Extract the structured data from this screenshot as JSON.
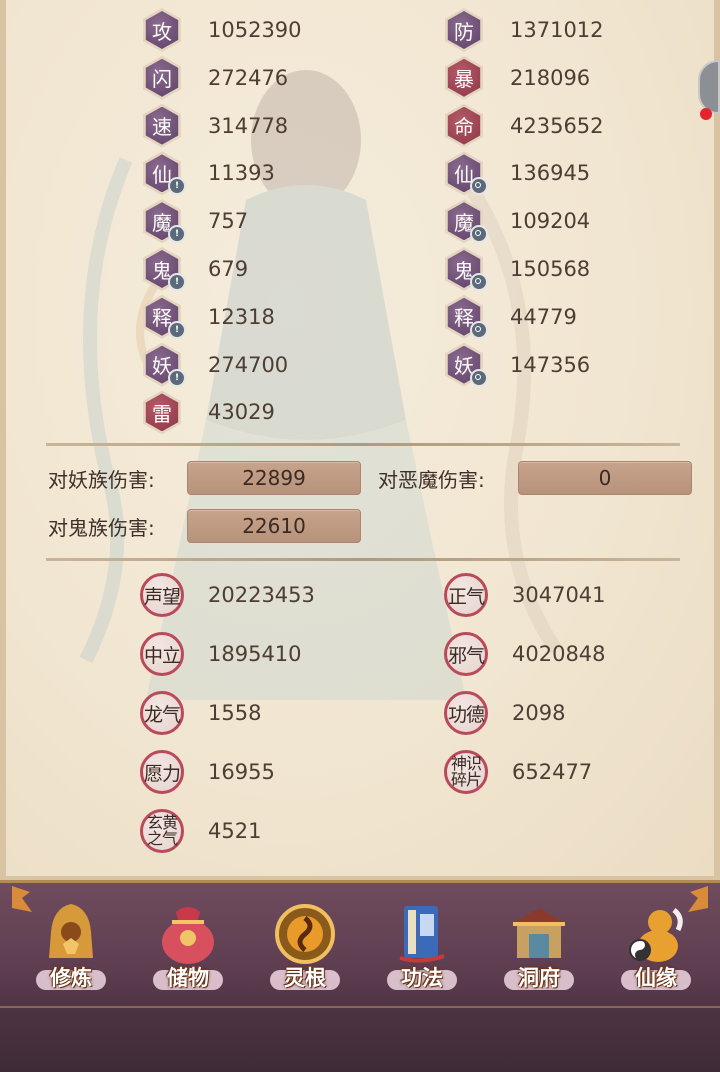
{
  "left_stats": [
    {
      "glyph": "攻",
      "value": "1052390",
      "color": "purple",
      "badge": ""
    },
    {
      "glyph": "闪",
      "value": "272476",
      "color": "purple",
      "badge": ""
    },
    {
      "glyph": "速",
      "value": "314778",
      "color": "purple",
      "badge": ""
    },
    {
      "glyph": "仙",
      "value": "11393",
      "color": "purple",
      "badge": "i"
    },
    {
      "glyph": "魔",
      "value": "757",
      "color": "purple",
      "badge": "i"
    },
    {
      "glyph": "鬼",
      "value": "679",
      "color": "purple",
      "badge": "i"
    },
    {
      "glyph": "释",
      "value": "12318",
      "color": "purple",
      "badge": "i"
    },
    {
      "glyph": "妖",
      "value": "274700",
      "color": "purple",
      "badge": "i"
    },
    {
      "glyph": "雷",
      "value": "43029",
      "color": "red",
      "badge": ""
    }
  ],
  "right_stats": [
    {
      "glyph": "防",
      "value": "1371012",
      "color": "purple",
      "badge": ""
    },
    {
      "glyph": "暴",
      "value": "218096",
      "color": "red",
      "badge": ""
    },
    {
      "glyph": "命",
      "value": "4235652",
      "color": "red",
      "badge": ""
    },
    {
      "glyph": "仙",
      "value": "136945",
      "color": "purple",
      "badge": "o"
    },
    {
      "glyph": "魔",
      "value": "109204",
      "color": "purple",
      "badge": "o"
    },
    {
      "glyph": "鬼",
      "value": "150568",
      "color": "purple",
      "badge": "o"
    },
    {
      "glyph": "释",
      "value": "44779",
      "color": "purple",
      "badge": "o"
    },
    {
      "glyph": "妖",
      "value": "147356",
      "color": "purple",
      "badge": "o"
    }
  ],
  "damage": {
    "demon_label": "对妖族伤害:",
    "demon_value": "22899",
    "evil_label": "对恶魔伤害:",
    "evil_value": "0",
    "ghost_label": "对鬼族伤害:",
    "ghost_value": "22610"
  },
  "reputation": [
    {
      "label": "声望",
      "value": "20223453"
    },
    {
      "label": "正气",
      "value": "3047041"
    },
    {
      "label": "中立",
      "value": "1895410"
    },
    {
      "label": "邪气",
      "value": "4020848"
    },
    {
      "label": "龙气",
      "value": "1558"
    },
    {
      "label": "功德",
      "value": "2098"
    },
    {
      "label": "愿力",
      "value": "16955"
    },
    {
      "label_line1": "神识",
      "label_line2": "碎片",
      "value": "652477"
    },
    {
      "label_line1": "玄黄",
      "label_line2": "之气",
      "value": "4521"
    }
  ],
  "nav": [
    {
      "label": "修炼",
      "icon": "cultivate-icon"
    },
    {
      "label": "储物",
      "icon": "storage-bag-icon"
    },
    {
      "label": "灵根",
      "icon": "spirit-root-icon"
    },
    {
      "label": "功法",
      "icon": "skill-book-icon"
    },
    {
      "label": "洞府",
      "icon": "cave-mansion-icon"
    },
    {
      "label": "仙缘",
      "icon": "immortal-gourd-icon"
    }
  ],
  "colors": {
    "hex_purple": "#6b4a72",
    "hex_red": "#9a4050",
    "nav_bg": "#5c3d4f",
    "badge_ring": "#b94a5a"
  }
}
